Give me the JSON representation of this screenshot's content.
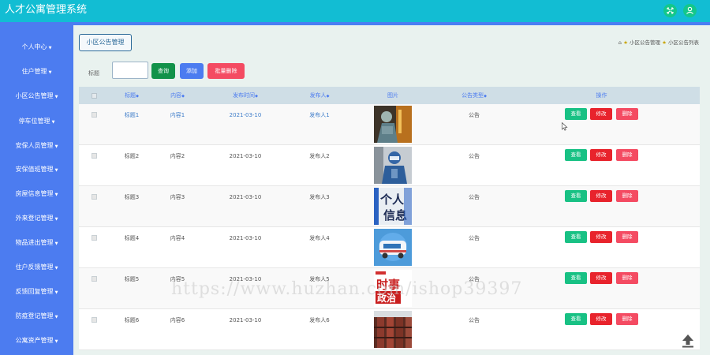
{
  "app": {
    "title": "人才公寓管理系统"
  },
  "sidebar": {
    "items": [
      {
        "label": "个人中心",
        "has_chevron": true
      },
      {
        "label": "住户管理",
        "has_chevron": true
      },
      {
        "label": "小区公告管理",
        "has_chevron": true
      },
      {
        "label": "停车位管理",
        "has_chevron": true
      },
      {
        "label": "安保人员管理",
        "has_chevron": true
      },
      {
        "label": "安保值班管理",
        "has_chevron": true
      },
      {
        "label": "房屋信息管理",
        "has_chevron": true
      },
      {
        "label": "外来登记管理",
        "has_chevron": true
      },
      {
        "label": "物品进出管理",
        "has_chevron": true
      },
      {
        "label": "住户反馈管理",
        "has_chevron": true
      },
      {
        "label": "反馈回复管理",
        "has_chevron": true
      },
      {
        "label": "防疫登记管理",
        "has_chevron": true
      },
      {
        "label": "公寓资产管理",
        "has_chevron": true
      }
    ]
  },
  "breadcrumb": {
    "current_box": "小区公告管理",
    "path": [
      "小区公告管理",
      "小区公告列表"
    ]
  },
  "search": {
    "label": "标题",
    "value": "",
    "placeholder": ""
  },
  "buttons": {
    "query": "查询",
    "add": "添加",
    "batch_delete": "批量删除"
  },
  "table": {
    "headers": [
      "标题",
      "内容",
      "发布时间",
      "发布人",
      "图片",
      "公告类型",
      "操作"
    ],
    "sort_mark": "◆",
    "rows": [
      {
        "title": "标题1",
        "content": "内容1",
        "time": "2021-03-10",
        "publisher": "发布人1",
        "type": "公告",
        "image": "photo-1"
      },
      {
        "title": "标题2",
        "content": "内容2",
        "time": "2021-03-10",
        "publisher": "发布人2",
        "type": "公告",
        "image": "photo-2"
      },
      {
        "title": "标题3",
        "content": "内容3",
        "time": "2021-03-10",
        "publisher": "发布人3",
        "type": "公告",
        "image": "photo-3"
      },
      {
        "title": "标题4",
        "content": "内容4",
        "time": "2021-03-10",
        "publisher": "发布人4",
        "type": "公告",
        "image": "photo-4"
      },
      {
        "title": "标题5",
        "content": "内容5",
        "time": "2021-03-10",
        "publisher": "发布人5",
        "type": "公告",
        "image": "photo-5"
      },
      {
        "title": "标题6",
        "content": "内容6",
        "time": "2021-03-10",
        "publisher": "发布人6",
        "type": "公告",
        "image": "photo-6"
      }
    ],
    "actions": {
      "view": "查看",
      "edit": "修改",
      "delete": "删除"
    }
  },
  "images": {
    "photo-3": {
      "line1": "个人",
      "line2": "信息"
    },
    "photo-5": {
      "line1": "时事",
      "line2": "政治"
    }
  },
  "watermark": "https://www.huzhan.com/ishop39397",
  "colors": {
    "topbar": "#12bdd3",
    "sidebar": "#4c7cf0",
    "view": "#18c184",
    "edit": "#e8232c",
    "delete": "#f44b62",
    "query": "#12924a"
  }
}
